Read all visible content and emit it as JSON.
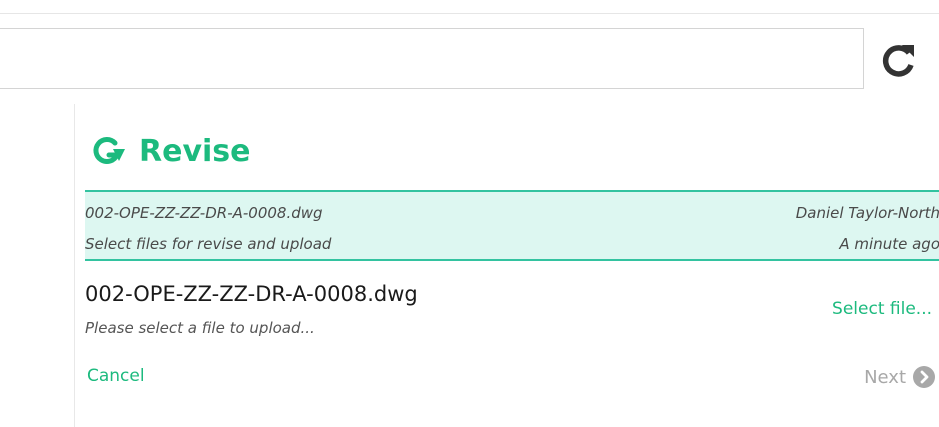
{
  "toolbar": {
    "search_value": "",
    "refresh_icon": "refresh-icon"
  },
  "dialog": {
    "title": "Revise",
    "title_icon": "revise-icon",
    "info": {
      "file_name": "002-OPE-ZZ-ZZ-DR-A-0008.dwg",
      "description": "Select files for revise and upload",
      "user": "Daniel Taylor-North",
      "time": "A minute ago"
    },
    "file": {
      "name": "002-OPE-ZZ-ZZ-DR-A-0008.dwg",
      "hint": "Please select a file to upload...",
      "select_label": "Select file..."
    },
    "cancel_label": "Cancel",
    "next_label": "Next",
    "next_icon": "chevron-right-circle-icon"
  },
  "colors": {
    "accent": "#1cba7e",
    "band_bg": "#ddf7f1",
    "band_border": "#33c3a0",
    "disabled": "#a8a8a8"
  }
}
